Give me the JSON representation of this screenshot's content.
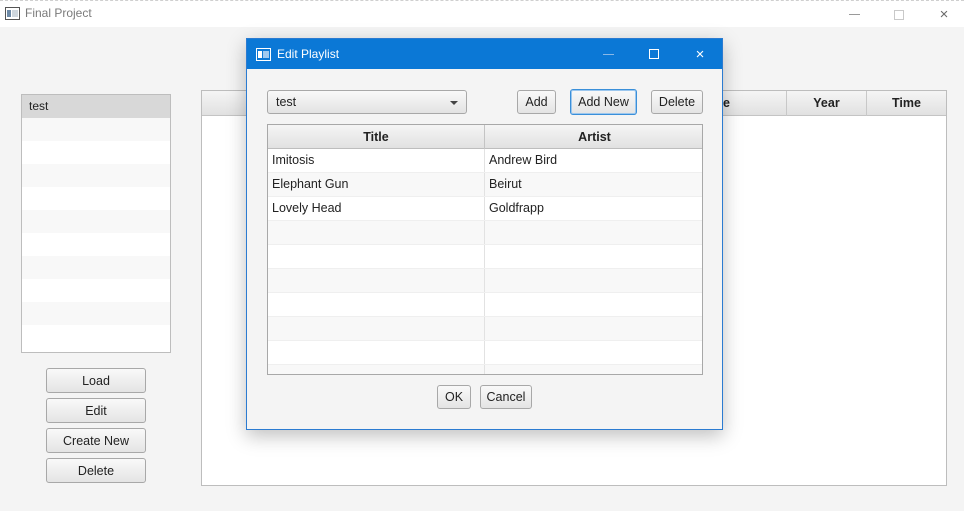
{
  "window": {
    "title": "Final Project",
    "controls": {
      "minimize": "minimize-icon",
      "maximize": "maximize-icon",
      "close": "×"
    }
  },
  "playlists": {
    "items": [
      "test",
      "",
      "",
      "",
      "",
      "",
      "",
      "",
      "",
      "",
      ""
    ],
    "selected": "test"
  },
  "left_buttons": {
    "load": "Load",
    "edit": "Edit",
    "create_new": "Create New",
    "delete": "Delete"
  },
  "songs_table": {
    "columns": [
      "e",
      "Year",
      "Time"
    ]
  },
  "dialog": {
    "title": "Edit Playlist",
    "close_glyph": "×",
    "combo_value": "test",
    "add_label": "Add",
    "add_new_label": "Add New",
    "delete_label": "Delete",
    "columns": {
      "title": "Title",
      "artist": "Artist"
    },
    "rows": [
      {
        "title": "Imitosis",
        "artist": "Andrew Bird"
      },
      {
        "title": "Elephant Gun",
        "artist": "Beirut"
      },
      {
        "title": "Lovely Head",
        "artist": "Goldfrapp"
      },
      {
        "title": "",
        "artist": ""
      },
      {
        "title": "",
        "artist": ""
      },
      {
        "title": "",
        "artist": ""
      },
      {
        "title": "",
        "artist": ""
      },
      {
        "title": "",
        "artist": ""
      },
      {
        "title": "",
        "artist": ""
      },
      {
        "title": "",
        "artist": ""
      }
    ],
    "ok_label": "OK",
    "cancel_label": "Cancel"
  },
  "colors": {
    "dialog_titlebar": "#0b78d6",
    "focus_border": "#3a8fd9",
    "background": "#f4f4f4"
  }
}
